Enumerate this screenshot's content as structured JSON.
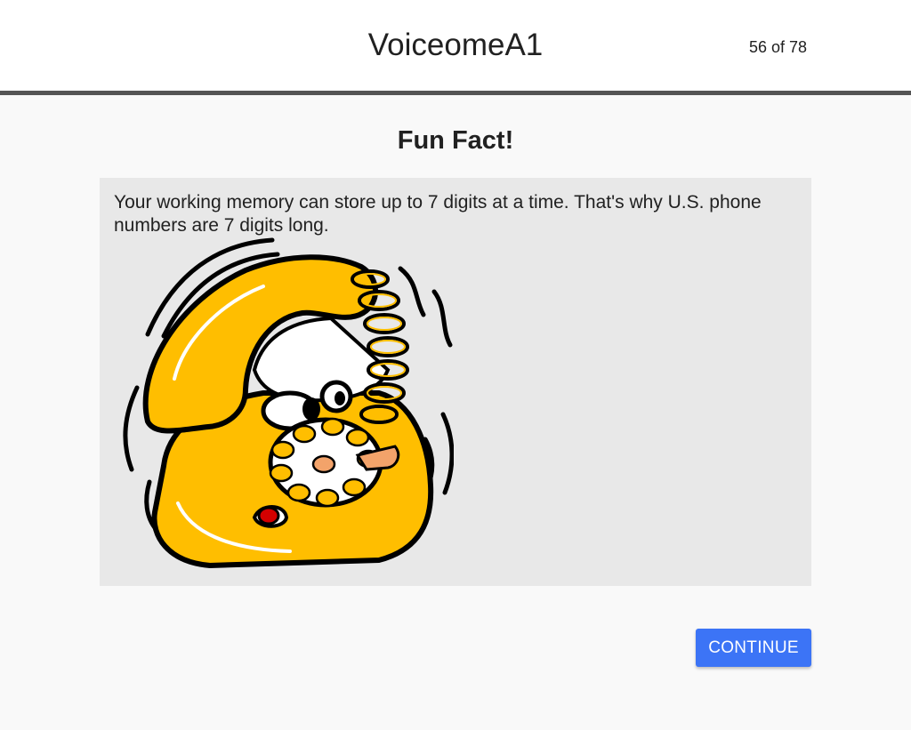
{
  "header": {
    "app_title": "VoiceomeA1",
    "progress": "56 of 78"
  },
  "main": {
    "page_title": "Fun Fact!",
    "fact_text": "Your working memory can store up to 7 digits at a time. That's why U.S. phone numbers are 7 digits long.",
    "illustration_icon": "cartoon-rotary-phone",
    "continue_label": "CONTINUE"
  },
  "colors": {
    "accent": "#3c74f6",
    "header_rule": "#555555",
    "card_background": "#e8e8e8",
    "page_background": "#f9f9f9",
    "phone_yellow": "#ffbe00"
  }
}
